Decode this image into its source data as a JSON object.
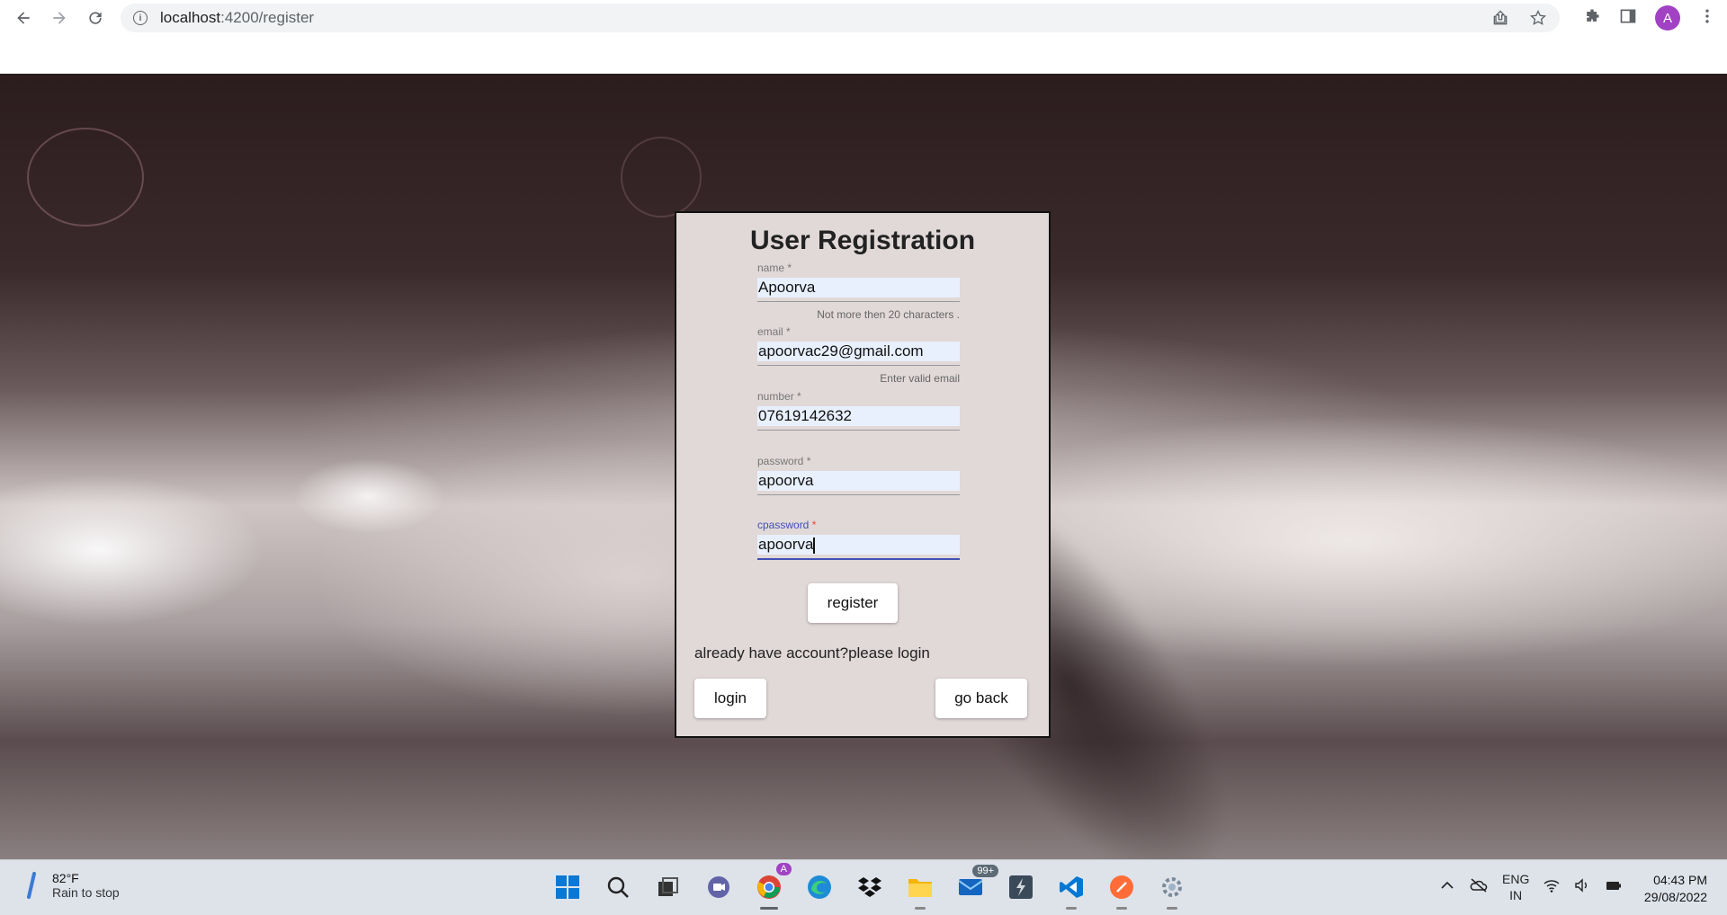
{
  "browser": {
    "url_host": "localhost",
    "url_path": ":4200/register",
    "profile_initial": "A"
  },
  "form": {
    "title": "User Registration",
    "fields": [
      {
        "label": "name",
        "required_mark": "*",
        "value": "Apoorva",
        "hint": "Not more then 20 characters ."
      },
      {
        "label": "email",
        "required_mark": "*",
        "value": "apoorvac29@gmail.com",
        "hint": "Enter valid email"
      },
      {
        "label": "number",
        "required_mark": "*",
        "value": "07619142632",
        "hint": ""
      },
      {
        "label": "password",
        "required_mark": "*",
        "value": "apoorva",
        "hint": ""
      },
      {
        "label": "cpassword",
        "required_mark": "*",
        "value": "apoorva",
        "hint": ""
      }
    ],
    "register_label": "register",
    "login_prompt": "already have account?please login",
    "login_label": "login",
    "go_back_label": "go back"
  },
  "taskbar": {
    "weather_temp": "82°F",
    "weather_desc": "Rain to stop",
    "mail_badge": "99+",
    "chrome_badge": "A",
    "lang_1": "ENG",
    "lang_2": "IN",
    "time": "04:43 PM",
    "date": "29/08/2022"
  },
  "colors": {
    "focus_accent": "#3f51b5",
    "required_focus": "#f44336",
    "autofill_bg": "#e8f0fe"
  }
}
